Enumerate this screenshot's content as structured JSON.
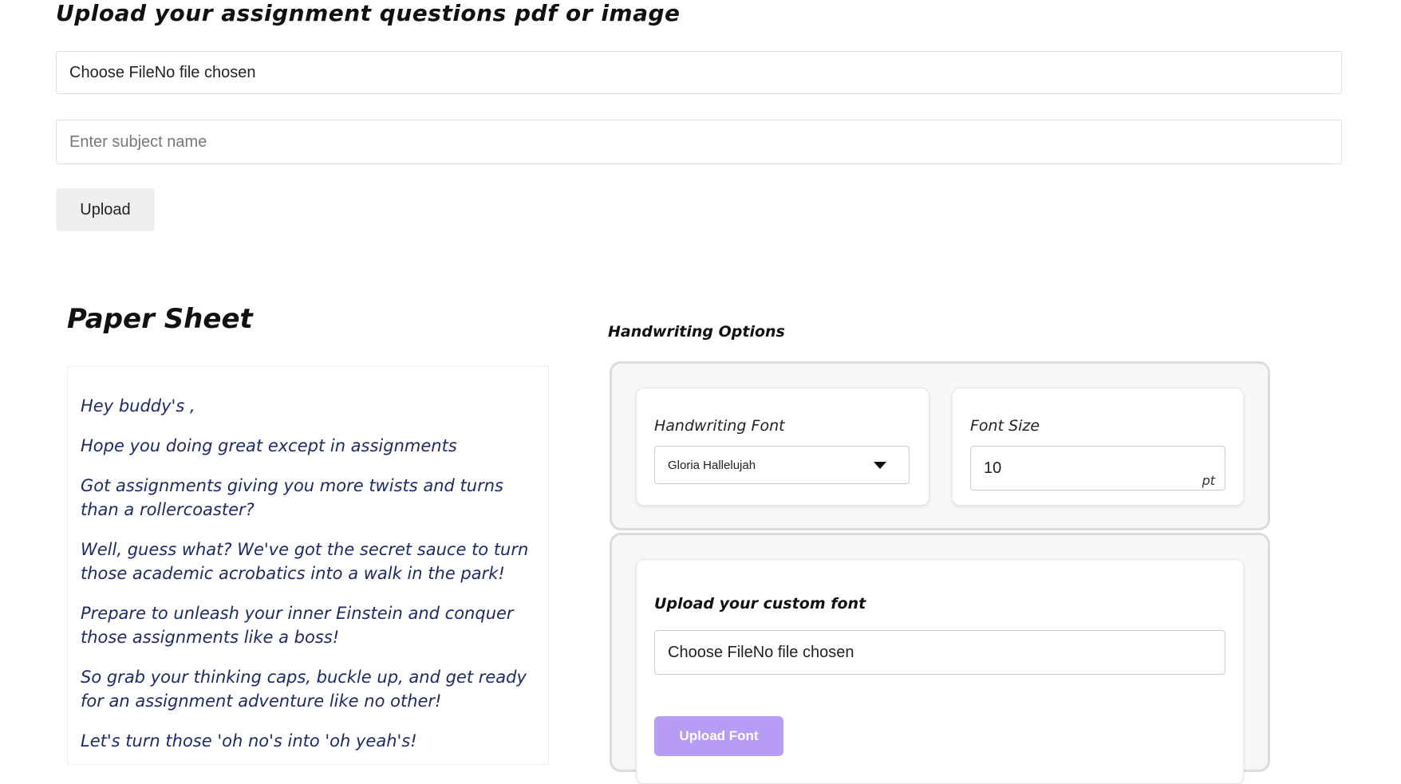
{
  "upload_section": {
    "heading": "Upload your assignment questions pdf or image",
    "file_input_text": "Choose FileNo file chosen",
    "subject_placeholder": "Enter subject name",
    "upload_label": "Upload"
  },
  "paper": {
    "title": "Paper Sheet",
    "lines": [
      "Hey buddy's ,",
      "Hope you doing great except in assignments",
      "Got assignments giving you more twists and turns than a rollercoaster?",
      "Well, guess what? We've got the secret sauce to turn those academic acrobatics into a walk in the park!",
      "Prepare to unleash your inner Einstein and conquer those assignments like a boss!",
      "So grab your thinking caps, buckle up, and get ready for an assignment adventure like no other!",
      "Let's turn those 'oh no's into 'oh yeah's!"
    ]
  },
  "options": {
    "title": "Handwriting Options",
    "font_label": "Handwriting Font",
    "font_selected": "Gloria Hallelujah",
    "size_label": "Font Size",
    "size_value": "10",
    "size_unit": "pt"
  },
  "custom_font": {
    "label": "Upload your custom font",
    "file_input_text": "Choose FileNo file chosen",
    "upload_label": "Upload Font"
  },
  "colors": {
    "accent": "#b79cf5",
    "paper_ink": "#1d2a6b",
    "panel_bg": "#f7f7f7"
  }
}
